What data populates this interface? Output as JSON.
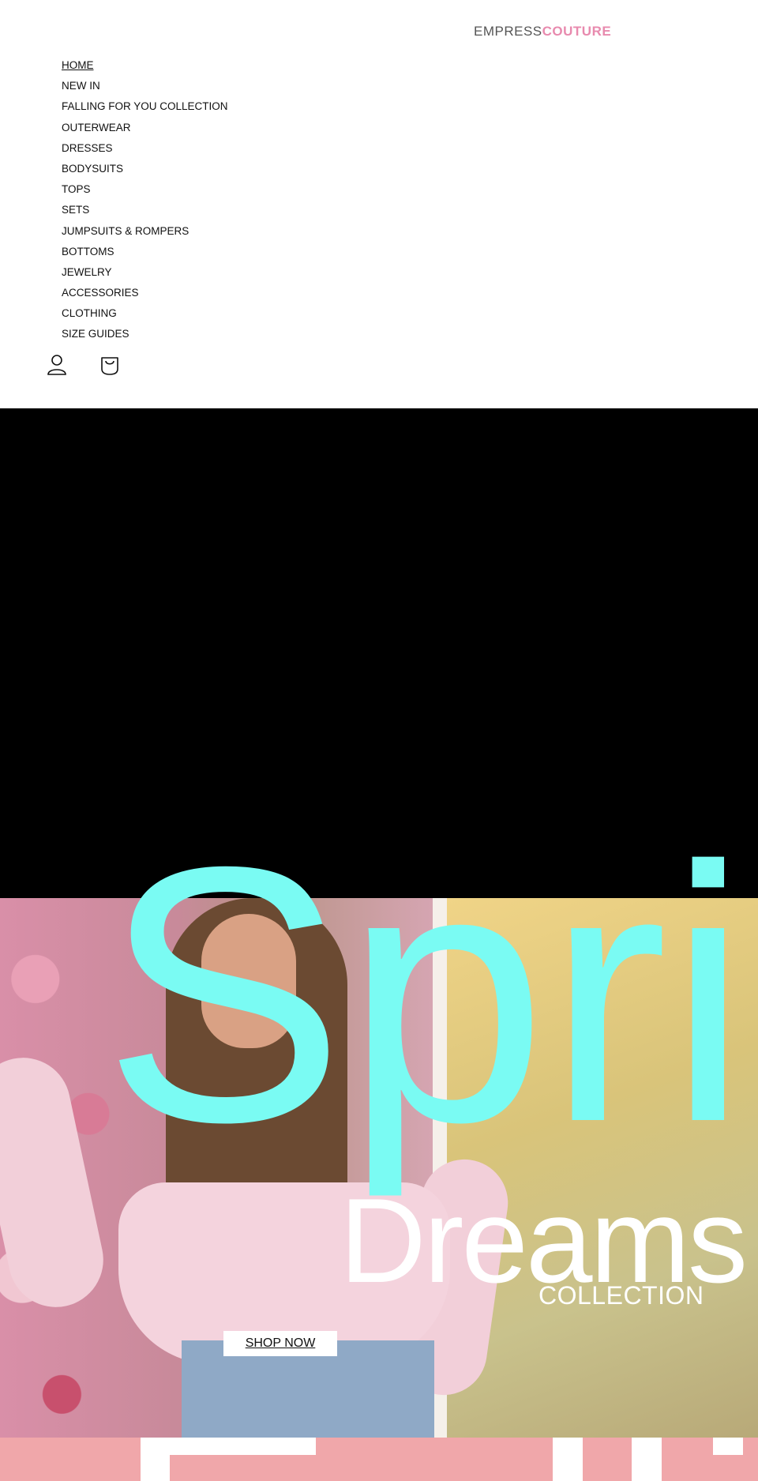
{
  "brand": {
    "part1": "EMPRESS",
    "part2": "COUTURE"
  },
  "nav": {
    "items": [
      {
        "label": "HOME"
      },
      {
        "label": "NEW IN"
      },
      {
        "label": "FALLING FOR YOU COLLECTION"
      },
      {
        "label": "OUTERWEAR"
      },
      {
        "label": "DRESSES"
      },
      {
        "label": "BODYSUITS"
      },
      {
        "label": "TOPS"
      },
      {
        "label": "SETS"
      },
      {
        "label": "JUMPSUITS & ROMPERS"
      },
      {
        "label": "BOTTOMS"
      },
      {
        "label": "JEWELRY"
      },
      {
        "label": "ACCESSORIES"
      },
      {
        "label": "CLOTHING"
      },
      {
        "label": "SIZE GUIDES"
      }
    ],
    "active": "HOME"
  },
  "icons": {
    "account": "user-icon",
    "cart": "shopping-bag-icon"
  },
  "hero": {
    "big_word": "Spring",
    "title": "Dreams",
    "subtitle": "COLLECTION",
    "cta": "SHOP NOW"
  },
  "colors": {
    "brand_pink": "#e88aae",
    "cyan_text": "#7afbf3",
    "banner_pink": "#f0a7aa",
    "black_block": "#000000"
  }
}
